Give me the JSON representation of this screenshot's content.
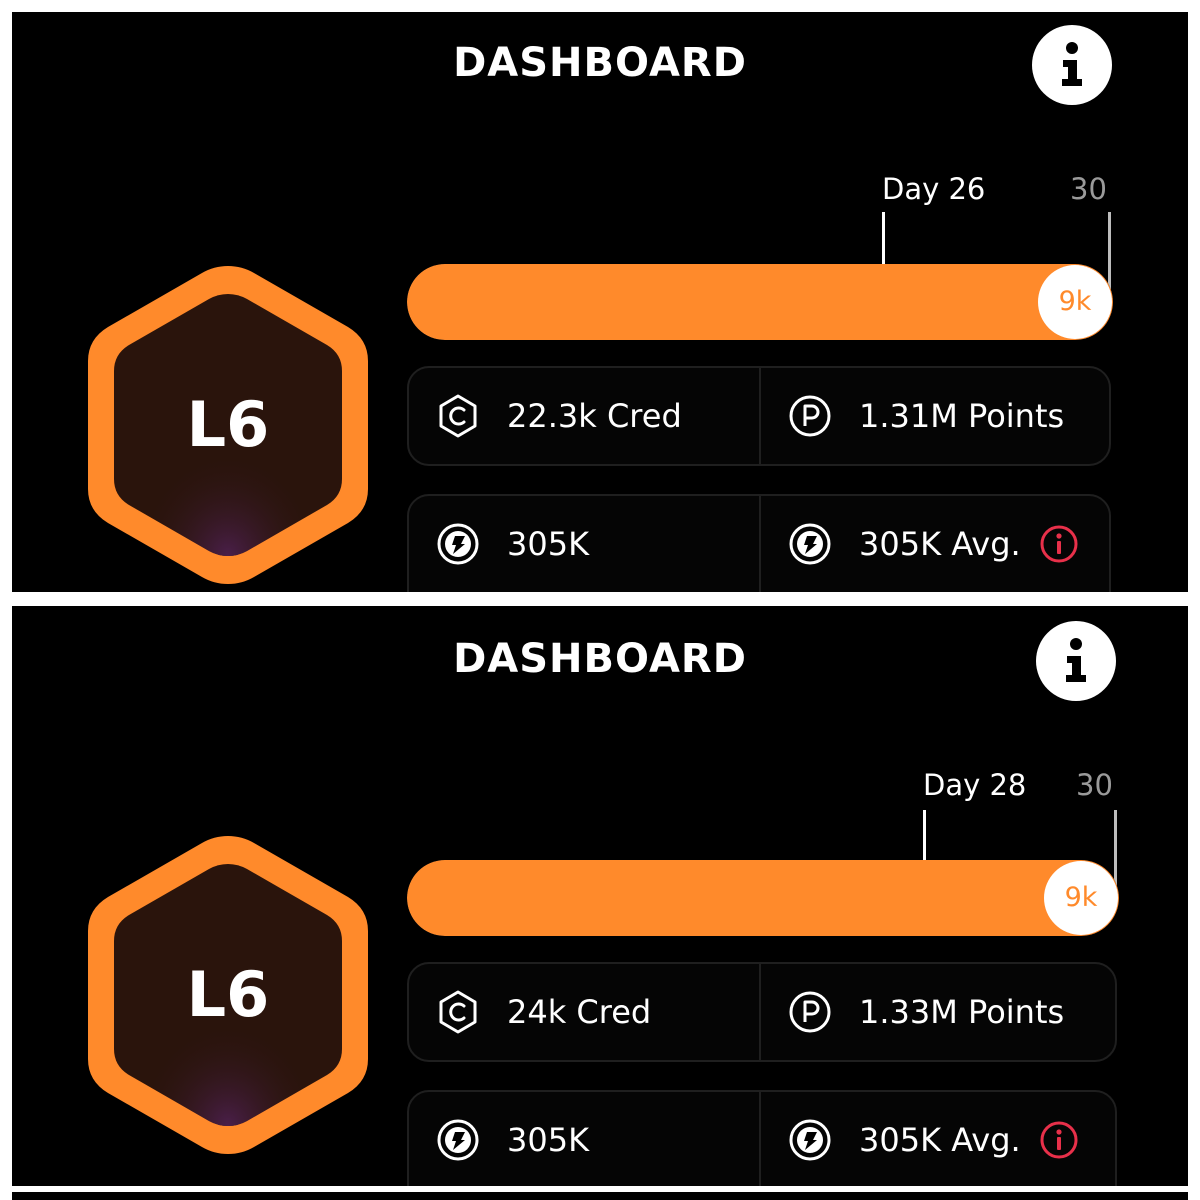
{
  "colors": {
    "accent": "#ff8a2b",
    "warning": "#e8304a",
    "background": "#000000"
  },
  "panels": [
    {
      "title": "DASHBOARD",
      "info_icon": "info-icon",
      "level": "L6",
      "day_label": "Day 26",
      "day": 26,
      "max_day": "30",
      "progress_value": "9k",
      "stats": {
        "cred": {
          "icon": "cred-coin-icon",
          "text": "22.3k Cred"
        },
        "points": {
          "icon": "points-coin-icon",
          "text": "1.31M Points"
        },
        "token": {
          "icon": "token-coin-icon",
          "text": "305K"
        },
        "token_avg": {
          "icon": "token-coin-icon",
          "text": "305K Avg.",
          "warning_icon": "info-warning-icon"
        }
      }
    },
    {
      "title": "DASHBOARD",
      "info_icon": "info-icon",
      "level": "L6",
      "day_label": "Day 28",
      "day": 28,
      "max_day": "30",
      "progress_value": "9k",
      "stats": {
        "cred": {
          "icon": "cred-coin-icon",
          "text": "24k Cred"
        },
        "points": {
          "icon": "points-coin-icon",
          "text": "1.33M Points"
        },
        "token": {
          "icon": "token-coin-icon",
          "text": "305K"
        },
        "token_avg": {
          "icon": "token-coin-icon",
          "text": "305K Avg.",
          "warning_icon": "info-warning-icon"
        }
      }
    }
  ]
}
